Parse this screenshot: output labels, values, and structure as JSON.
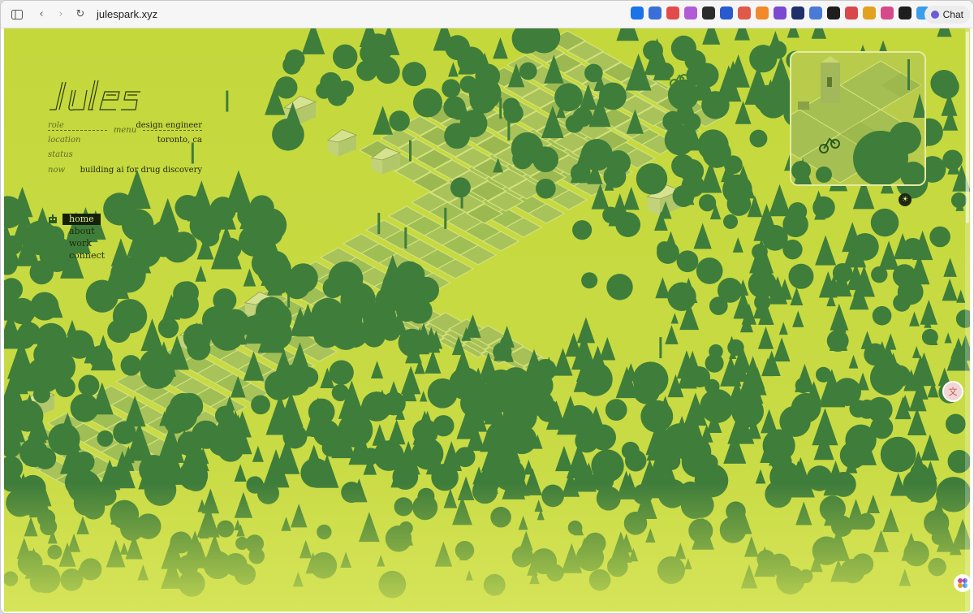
{
  "browser": {
    "url": "julespark.xyz",
    "chat_label": "Chat",
    "extensions": [
      {
        "name": "google-icon",
        "color": "#1a73e8"
      },
      {
        "name": "translate-icon",
        "color": "#3b6fd8"
      },
      {
        "name": "seven-icon",
        "color": "#e34b4b"
      },
      {
        "name": "brain-icon",
        "color": "#b25bd6"
      },
      {
        "name": "box-icon",
        "color": "#2c2c2c"
      },
      {
        "name": "ring-icon",
        "color": "#2a5ad0"
      },
      {
        "name": "zoom-icon",
        "color": "#e05a4a"
      },
      {
        "name": "star-icon",
        "color": "#f08a2a"
      },
      {
        "name": "lab-icon",
        "color": "#7a4ad0"
      },
      {
        "name": "map-icon",
        "color": "#1f2f6a"
      },
      {
        "name": "doc-icon",
        "color": "#4a7ad8"
      },
      {
        "name": "notion-icon",
        "color": "#1e1e1e"
      },
      {
        "name": "pokeball-icon",
        "color": "#d94848"
      },
      {
        "name": "p-icon",
        "color": "#e2a21f"
      },
      {
        "name": "calendar-icon",
        "color": "#d64a8a"
      },
      {
        "name": "quote-icon",
        "color": "#1e1e1e"
      },
      {
        "name": "bird-icon",
        "color": "#3a9ee8"
      }
    ]
  },
  "site": {
    "logo_text": "jules",
    "menu_label": "menu",
    "info": [
      {
        "key": "role",
        "value": "design engineer"
      },
      {
        "key": "location",
        "value": "toronto, ca"
      },
      {
        "key": "status",
        "value": ""
      },
      {
        "key": "now",
        "value": "building ai for drug discovery"
      }
    ],
    "nav": [
      {
        "label": "home",
        "active": true
      },
      {
        "label": "about",
        "active": false
      },
      {
        "label": "work",
        "active": false
      },
      {
        "label": "connect",
        "active": false
      }
    ],
    "colors": {
      "grass": "#c6d93f",
      "forest": "#3f7d3b",
      "tile": "#9fbf55"
    }
  }
}
